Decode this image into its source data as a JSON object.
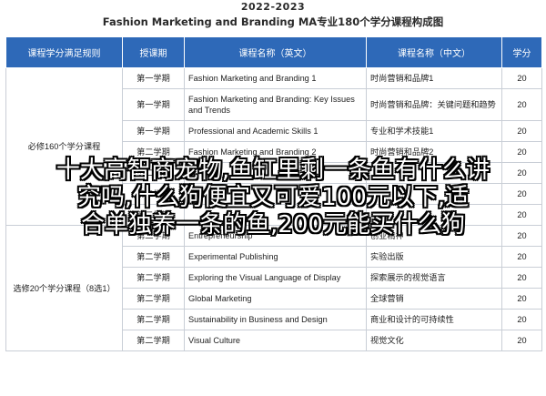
{
  "document": {
    "subtitle": "2022-2023",
    "title": "Fashion Marketing and Branding MA专业180个学分课程构成图"
  },
  "table": {
    "headers": {
      "group": "课程学分满足规则",
      "term": "授课期",
      "name_en": "课程名称（英文）",
      "name_cn": "课程名称（中文）",
      "credits": "学分"
    },
    "groups": {
      "compulsory": "必修160个学分课程",
      "elective": "选修20个学分课程（8选1）"
    },
    "rows": [
      {
        "term": "第一学期",
        "name_en": "Fashion Marketing and Branding 1",
        "name_cn": "时尚营销和品牌1",
        "credits": "20"
      },
      {
        "term": "第一学期",
        "name_en": "Fashion Marketing and Branding: Key Issues and Trends",
        "name_cn": "时尚营销和品牌：关键问题和趋势",
        "credits": "20"
      },
      {
        "term": "第一学期",
        "name_en": "Professional and Academic Skills 1",
        "name_cn": "专业和学术技能1",
        "credits": "20"
      },
      {
        "term": "第二学期",
        "name_en": "Fashion Marketing and Branding 2",
        "name_cn": "时尚营销和品牌2",
        "credits": "20"
      },
      {
        "term": "第二学期",
        "name_en": "",
        "name_cn": "",
        "credits": "20"
      },
      {
        "term": "第二学期",
        "name_en": "",
        "name_cn": "",
        "credits": "20"
      },
      {
        "term": "第二学期",
        "name_en": "",
        "name_cn": "",
        "credits": "20"
      },
      {
        "term": "第二学期",
        "name_en": "Entrepreneurship",
        "name_cn": "创业精神",
        "credits": "20"
      },
      {
        "term": "第二学期",
        "name_en": "Experimental Publishing",
        "name_cn": "实验出版",
        "credits": "20"
      },
      {
        "term": "第二学期",
        "name_en": "Exploring the Visual Language of Display",
        "name_cn": "探索展示的视觉语言",
        "credits": "20"
      },
      {
        "term": "第二学期",
        "name_en": "Global Marketing",
        "name_cn": "全球营销",
        "credits": "20"
      },
      {
        "term": "第二学期",
        "name_en": "Sustainability in Business and Design",
        "name_cn": "商业和设计的可持续性",
        "credits": "20"
      },
      {
        "term": "第二学期",
        "name_en": "Visual Culture",
        "name_cn": "视觉文化",
        "credits": "20"
      }
    ]
  },
  "overlay": {
    "line1": "十大高智商宠物,鱼缸里剩一条鱼有什么讲",
    "line2": "究吗,什么狗便宜又可爱100元以下,适",
    "line3": "合单独养一条的鱼,200元能买什么狗"
  }
}
